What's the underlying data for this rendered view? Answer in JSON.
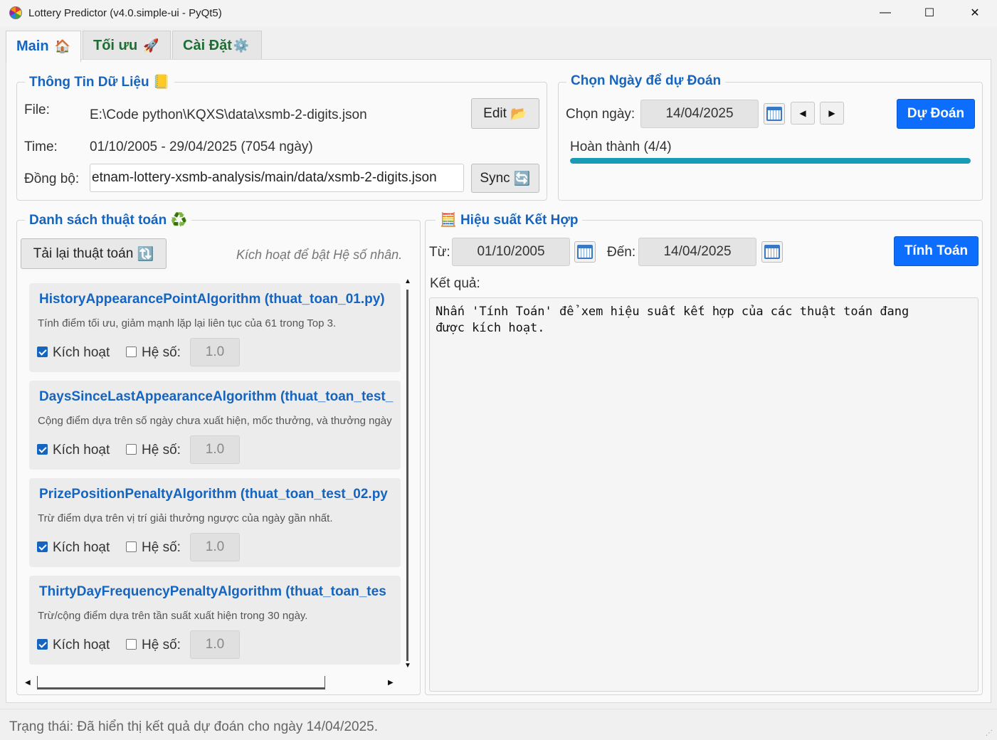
{
  "window": {
    "title": "Lottery Predictor (v4.0.simple-ui - PyQt5)",
    "minimize": "—",
    "maximize": "☐",
    "close": "✕"
  },
  "tabs": [
    {
      "label": "Main",
      "icon": "🏠",
      "active": true
    },
    {
      "label": "Tối ưu",
      "icon": "🚀",
      "active": false
    },
    {
      "label": "Cài Đặt",
      "icon": "⚙️",
      "active": false
    }
  ],
  "data_info": {
    "title": "Thông Tin Dữ Liệu",
    "title_icon": "📒",
    "file_label": "File:",
    "file_value": "E:\\Code python\\KQXS\\data\\xsmb-2-digits.json",
    "edit_button": "Edit",
    "edit_icon": "📂",
    "time_label": "Time:",
    "time_value": "01/10/2005 - 29/04/2025 (7054 ngày)",
    "sync_label": "Đồng bộ:",
    "sync_value": "etnam-lottery-xsmb-analysis/main/data/xsmb-2-digits.json",
    "sync_button": "Sync",
    "sync_icon": "🔄"
  },
  "predict": {
    "title": "Chọn Ngày để dự Đoán",
    "date_label": "Chọn ngày:",
    "date_value": "14/04/2025",
    "prev_icon": "◀",
    "next_icon": "▶",
    "predict_button": "Dự Đoán",
    "progress_text": "Hoàn thành (4/4)",
    "progress_fraction": 1.0,
    "accent_color": "#0d6efd",
    "progress_color": "#1a9bb5"
  },
  "algorithms": {
    "title": "Danh sách thuật toán",
    "title_icon": "♻️",
    "reload_button": "Tải lại thuật toán",
    "reload_icon": "🔃",
    "hint": "Kích hoạt để bật Hệ số nhân.",
    "active_label": "Kích hoạt",
    "coef_label": "Hệ số:",
    "items": [
      {
        "name": "HistoryAppearancePointAlgorithm (thuat_toan_01.py)",
        "desc": "Tính điểm tối ưu, giảm mạnh lặp lại liên tục của 61 trong Top 3.",
        "active": true,
        "coef_enabled": false,
        "coef": "1.0"
      },
      {
        "name": "DaysSinceLastAppearanceAlgorithm (thuat_toan_test_",
        "desc": "Cộng điểm dựa trên số ngày chưa xuất hiện, mốc thưởng, và thưởng ngày",
        "active": true,
        "coef_enabled": false,
        "coef": "1.0"
      },
      {
        "name": "PrizePositionPenaltyAlgorithm (thuat_toan_test_02.py",
        "desc": "Trừ điểm dựa trên vị trí giải thưởng ngược của ngày gần nhất.",
        "active": true,
        "coef_enabled": false,
        "coef": "1.0"
      },
      {
        "name": "ThirtyDayFrequencyPenaltyAlgorithm (thuat_toan_tes",
        "desc": "Trừ/cộng điểm dựa trên tần suất xuất hiện trong 30 ngày.",
        "active": true,
        "coef_enabled": false,
        "coef": "1.0"
      }
    ]
  },
  "performance": {
    "title": "Hiệu suất Kết Hợp",
    "title_icon": "🧮",
    "from_label": "Từ:",
    "from_value": "01/10/2005",
    "to_label": "Đến:",
    "to_value": "14/04/2025",
    "calc_button": "Tính Toán",
    "result_label": "Kết quả:",
    "result_text": "Nhấn 'Tính Toán' để xem hiệu suất kết hợp của các thuật toán đang\nđược kích hoạt."
  },
  "status": {
    "text": "Trạng thái: Đã hiển thị kết quả dự đoán cho ngày 14/04/2025."
  }
}
